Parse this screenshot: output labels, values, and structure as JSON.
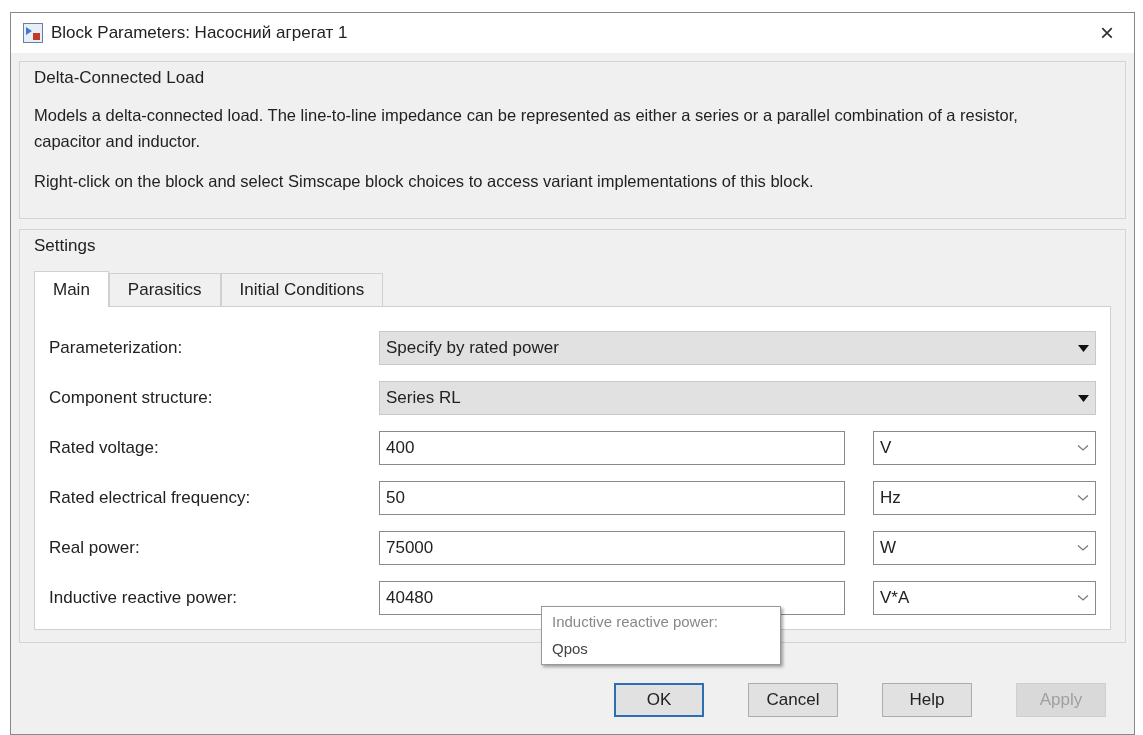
{
  "window": {
    "title": "Block Parameters: Насосний агрегат 1",
    "close": "×"
  },
  "block": {
    "title": "Delta-Connected Load",
    "description": [
      "Models a delta-connected load. The line-to-line impedance can be represented as either a series or a parallel combination of a resistor, capacitor and inductor.",
      "Right-click on the block and select Simscape block choices to access variant implementations of this block."
    ]
  },
  "settings": {
    "title": "Settings",
    "tabs": [
      {
        "label": "Main",
        "selected": true
      },
      {
        "label": "Parasitics",
        "selected": false
      },
      {
        "label": "Initial Conditions",
        "selected": false
      }
    ],
    "rows": [
      {
        "kind": "dropdown",
        "label": "Parameterization:",
        "value": "Specify by rated power"
      },
      {
        "kind": "dropdown",
        "label": "Component structure:",
        "value": "Series RL"
      },
      {
        "kind": "value",
        "label": "Rated voltage:",
        "value": "400",
        "unit": "V"
      },
      {
        "kind": "value",
        "label": "Rated electrical frequency:",
        "value": "50",
        "unit": "Hz"
      },
      {
        "kind": "value",
        "label": "Real power:",
        "value": "75000",
        "unit": "W"
      },
      {
        "kind": "value",
        "label": "Inductive reactive power:",
        "value": "40480",
        "unit": "V*A"
      }
    ]
  },
  "tooltip": {
    "title": "Inductive reactive power:",
    "name": "Qpos"
  },
  "buttons": [
    {
      "label": "OK",
      "default": true,
      "disabled": false
    },
    {
      "label": "Cancel",
      "default": false,
      "disabled": false
    },
    {
      "label": "Help",
      "default": false,
      "disabled": false
    },
    {
      "label": "Apply",
      "default": false,
      "disabled": true
    }
  ]
}
